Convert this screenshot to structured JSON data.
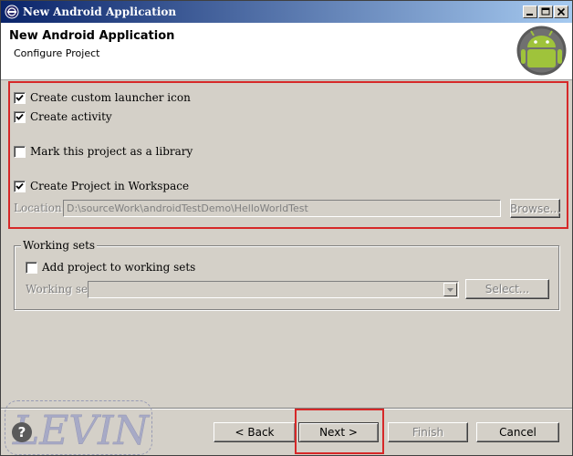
{
  "window": {
    "title": "New Android Application",
    "controls": {
      "minimize": "minimize",
      "maximize": "maximize",
      "close": "close"
    }
  },
  "header": {
    "title": "New Android Application",
    "subtitle": "Configure Project",
    "logo_icon": "android-logo-icon"
  },
  "options": [
    {
      "label": "Create custom launcher icon",
      "checked": true
    },
    {
      "label": "Create activity",
      "checked": true
    },
    {
      "label": "Mark this project as a library",
      "checked": false
    },
    {
      "label": "Create Project in Workspace",
      "checked": true
    }
  ],
  "location": {
    "label": "Location:",
    "value": "D:\\sourceWork\\androidTestDemo\\HelloWorldTest",
    "browse_label": "Browse..."
  },
  "working_sets": {
    "group_label": "Working sets",
    "add_label": "Add project to working sets",
    "add_checked": false,
    "field_label": "Working sets:",
    "value": "",
    "select_label": "Select..."
  },
  "footer": {
    "help_label": "?",
    "back_label": "< Back",
    "next_label": "Next >",
    "finish_label": "Finish",
    "cancel_label": "Cancel"
  },
  "watermark": "LEVIN",
  "colors": {
    "titlebar_start": "#0a246a",
    "titlebar_end": "#a6caf0",
    "highlight_red": "#d62828",
    "android_green": "#9fc33b",
    "face": "#d4d0c8"
  }
}
